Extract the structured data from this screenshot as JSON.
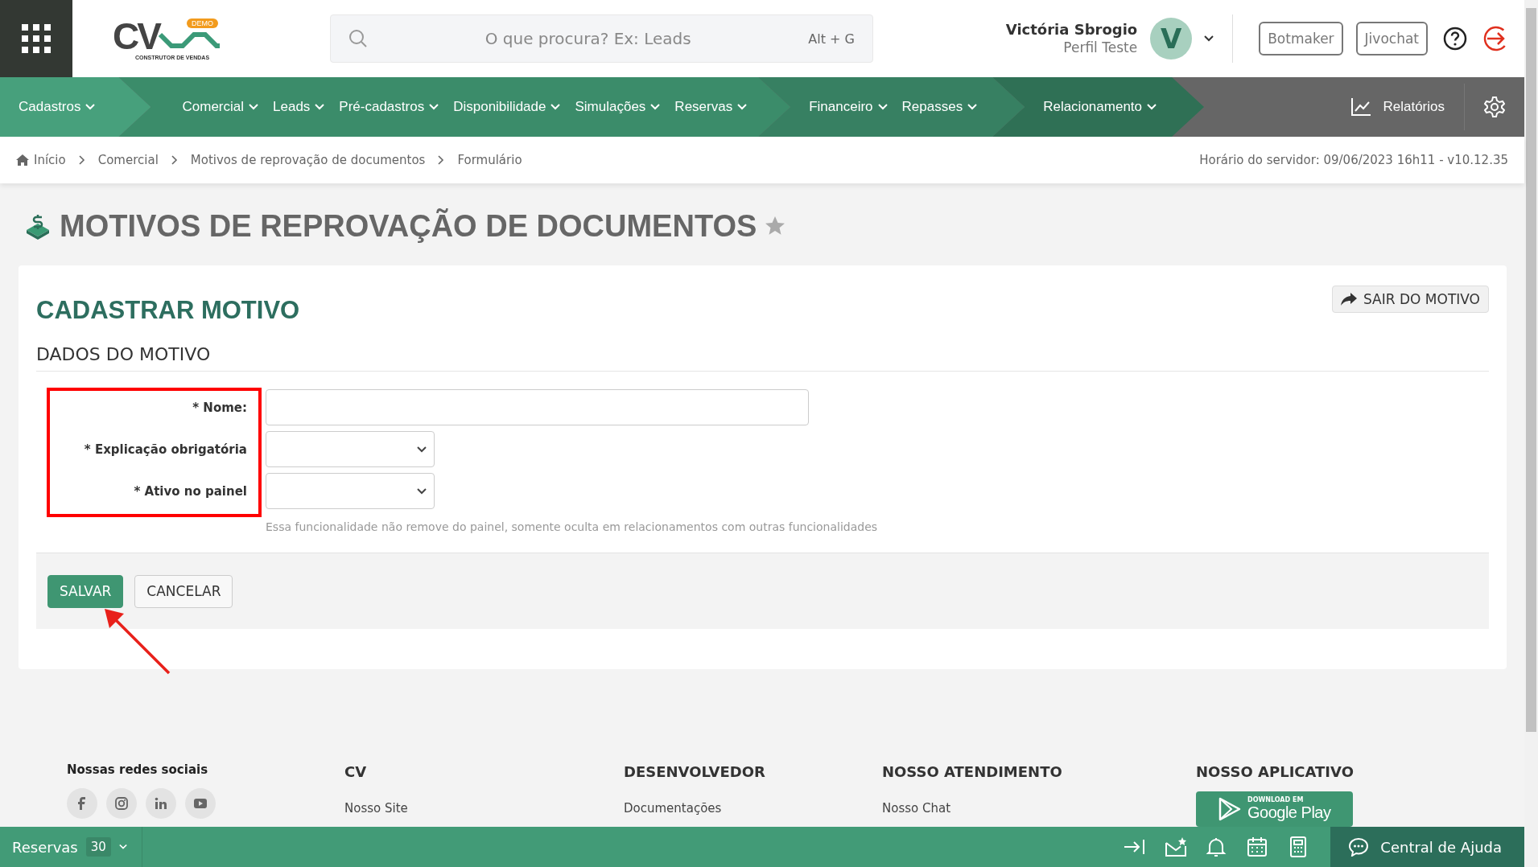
{
  "header": {
    "logo": {
      "wordmark": "CV",
      "badge": "DEMO",
      "tagline": "CONSTRUTOR DE VENDAS"
    },
    "search": {
      "placeholder": "O que procura? Ex: Leads",
      "shortcut": "Alt + G"
    },
    "user": {
      "name": "Victória Sbrogio",
      "profile": "Perfil Teste",
      "initial": "V"
    },
    "buttons": [
      "Botmaker",
      "Jivochat"
    ]
  },
  "nav": {
    "groups": [
      {
        "items": [
          "Cadastros"
        ]
      },
      {
        "items": [
          "Comercial",
          "Leads",
          "Pré-cadastros",
          "Disponibilidade",
          "Simulações",
          "Reservas"
        ]
      },
      {
        "items": [
          "Financeiro",
          "Repasses"
        ]
      },
      {
        "items": [
          "Relacionamento"
        ]
      }
    ],
    "reports": "Relatórios"
  },
  "breadcrumb": {
    "items": [
      "Início",
      "Comercial",
      "Motivos de reprovação de documentos",
      "Formulário"
    ],
    "server_time": "Horário do servidor: 09/06/2023 16h11 - v10.12.35"
  },
  "page_title": "MOTIVOS DE REPROVAÇÃO DE DOCUMENTOS",
  "card": {
    "title": "CADASTRAR MOTIVO",
    "exit_button": "SAIR DO MOTIVO",
    "section": "DADOS DO MOTIVO",
    "fields": [
      {
        "label": "* Nome:",
        "kind": "text"
      },
      {
        "label": "* Explicação obrigatória",
        "kind": "select"
      },
      {
        "label": "* Ativo no painel",
        "kind": "select"
      }
    ],
    "hint": "Essa funcionalidade não remove do painel, somente oculta em relacionamentos com outras funcionalidades",
    "buttons": [
      {
        "label": "SALVAR",
        "kind": "primary"
      },
      {
        "label": "CANCELAR",
        "kind": "secondary"
      }
    ]
  },
  "footer": {
    "social_title": "Nossas redes sociais",
    "columns": [
      {
        "title": "CV",
        "links": [
          "Nosso Site"
        ]
      },
      {
        "title": "DESENVOLVEDOR",
        "links": [
          "Documentações"
        ]
      },
      {
        "title": "NOSSO ATENDIMENTO",
        "links": [
          "Nosso Chat"
        ]
      }
    ],
    "app": {
      "title": "NOSSO APLICATIVO",
      "badge_top": "DOWNLOAD EM",
      "badge_name": "Google Play"
    }
  },
  "bottom_bar": {
    "label": "Reservas",
    "count": "30",
    "help": "Central de Ajuda"
  }
}
